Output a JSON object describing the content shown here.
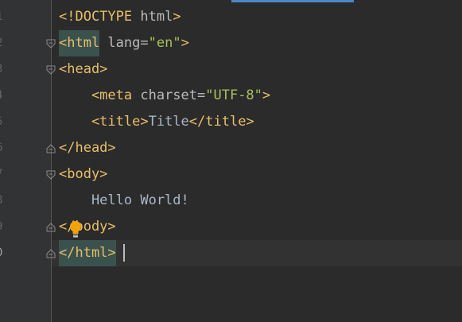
{
  "editor": {
    "line_numbers": [
      "1",
      "2",
      "3",
      "4",
      "5",
      "6",
      "7",
      "8",
      "9",
      "0"
    ],
    "lines": [
      {
        "parts": [
          {
            "cls": "tag",
            "text": "<!DOCTYPE "
          },
          {
            "cls": "attr",
            "text": "html"
          },
          {
            "cls": "tag",
            "text": ">"
          }
        ]
      },
      {
        "parts": [
          {
            "cls": "tag hl",
            "text": "<html"
          },
          {
            "cls": "attr",
            "text": " lang="
          },
          {
            "cls": "val",
            "text": "\"en\""
          },
          {
            "cls": "tag",
            "text": ">"
          }
        ]
      },
      {
        "parts": [
          {
            "cls": "tag",
            "text": "<head>"
          }
        ]
      },
      {
        "parts": [
          {
            "cls": "tag",
            "text": "    <meta "
          },
          {
            "cls": "attr",
            "text": "charset="
          },
          {
            "cls": "val",
            "text": "\"UTF-8\""
          },
          {
            "cls": "tag",
            "text": ">"
          }
        ]
      },
      {
        "parts": [
          {
            "cls": "tag",
            "text": "    <title>"
          },
          {
            "cls": "txt",
            "text": "Title"
          },
          {
            "cls": "tag",
            "text": "</title>"
          }
        ]
      },
      {
        "parts": [
          {
            "cls": "tag",
            "text": "</head>"
          }
        ]
      },
      {
        "parts": [
          {
            "cls": "tag",
            "text": "<body>"
          }
        ]
      },
      {
        "parts": [
          {
            "cls": "txt",
            "text": "    Hello World!"
          }
        ]
      },
      {
        "parts": [
          {
            "cls": "tag",
            "text": "</body>"
          }
        ]
      },
      {
        "parts": [
          {
            "cls": "tag hl",
            "text": "</html>"
          }
        ]
      }
    ],
    "current_line": 10,
    "fold_lines": [
      2,
      3,
      6,
      7,
      9,
      10
    ],
    "intention_icon": "lightbulb-icon"
  },
  "colors": {
    "background": "#2b2b2b",
    "tag": "#e8bf6a",
    "attribute": "#bababa",
    "string": "#a5c25c",
    "text": "#a9b7c6",
    "tag_highlight": "#3b514d",
    "bulb": "#f0a30a"
  }
}
